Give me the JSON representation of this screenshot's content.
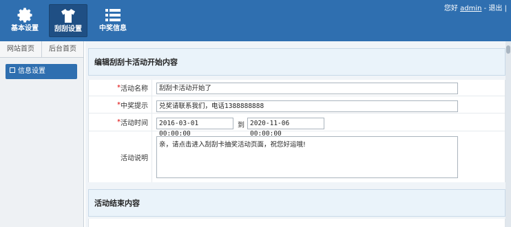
{
  "nav": {
    "items": [
      {
        "label": "基本设置",
        "icon": "gear-icon"
      },
      {
        "label": "刮刮设置",
        "icon": "shirt-icon"
      },
      {
        "label": "中奖信息",
        "icon": "list-icon"
      }
    ]
  },
  "userbar": {
    "greeting": "您好",
    "username": "admin",
    "separator": "-",
    "logout": "退出",
    "divider": "|"
  },
  "sidebar": {
    "tabs": [
      "网站首页",
      "后台首页"
    ],
    "menu": {
      "label": "信息设置"
    }
  },
  "main": {
    "section1_title": "编辑刮刮卡活动开始内容",
    "section2_title": "活动结束内容",
    "fields": {
      "name": {
        "required_mark": "*",
        "label": "活动名称",
        "value": "刮刮卡活动开始了"
      },
      "prize_tip": {
        "required_mark": "*",
        "label": "中奖提示",
        "value": "兑奖请联系我们，电话1388888888"
      },
      "time": {
        "required_mark": "*",
        "label": "活动时间",
        "start": "2016-03-01 00:00:00",
        "to": "到",
        "end": "2020-11-06 00:00:00"
      },
      "desc": {
        "label": "活动说明",
        "value": "亲，请点击进入刮刮卡抽奖活动页面，祝您好运哦!"
      }
    }
  },
  "colors": {
    "topbar": "#2f6fb0",
    "active_nav": "#1f4f84",
    "required": "#dd0000"
  }
}
